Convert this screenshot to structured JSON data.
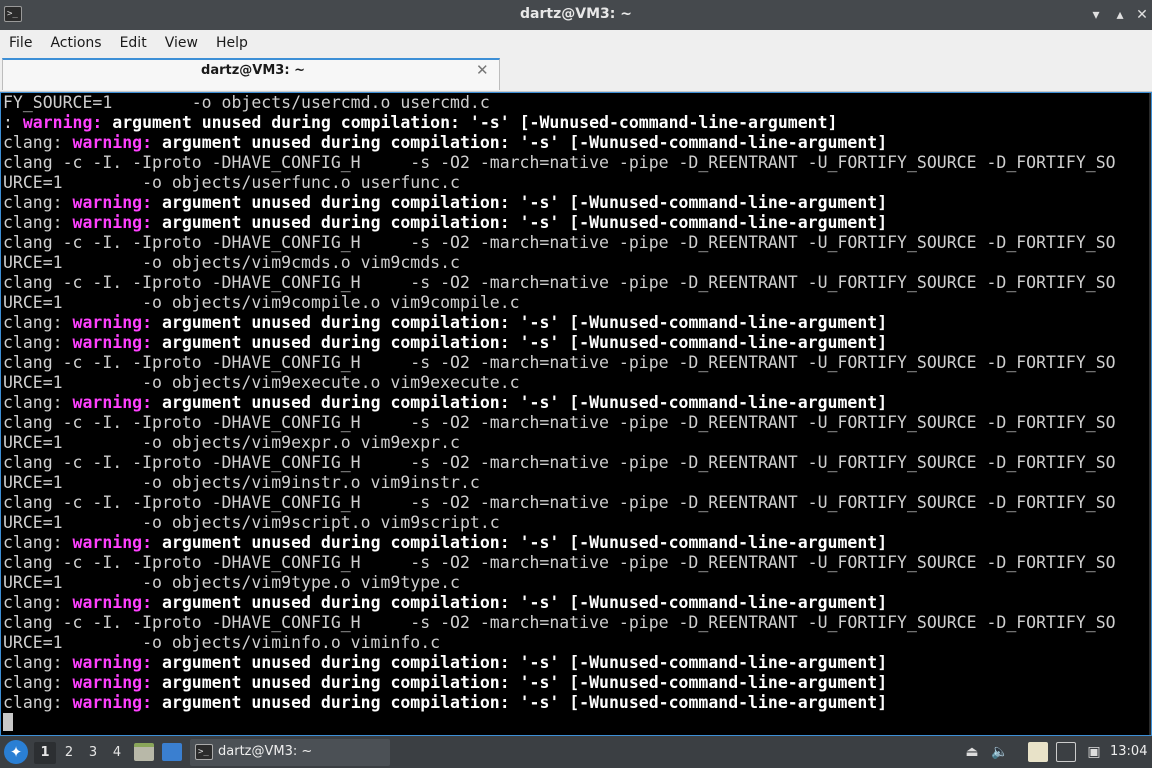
{
  "window": {
    "title": "dartz@VM3: ~",
    "minimize": "▾",
    "maximize": "▴",
    "close": "✕"
  },
  "menu": [
    "File",
    "Actions",
    "Edit",
    "View",
    "Help"
  ],
  "tab": {
    "label": "dartz@VM3: ~",
    "close": "✕"
  },
  "colors": {
    "warning": "#ff40ff",
    "accent": "#3d8fd6",
    "terminal_bg": "#000000"
  },
  "terminal_lines": [
    [
      {
        "t": "FY_SOURCE=1        -o objects/usercmd.o usercmd.c",
        "c": ""
      }
    ],
    [
      {
        "t": ": ",
        "c": ""
      },
      {
        "t": "warning:",
        "c": "warn"
      },
      {
        "t": " argument unused during compilation: '-s' [-Wunused-command-line-argument]",
        "c": "bold"
      }
    ],
    [
      {
        "t": "clang: ",
        "c": ""
      },
      {
        "t": "warning:",
        "c": "warn"
      },
      {
        "t": " argument unused during compilation: '-s' [-Wunused-command-line-argument]",
        "c": "bold"
      }
    ],
    [
      {
        "t": "clang -c -I. -Iproto -DHAVE_CONFIG_H     -s -O2 -march=native -pipe -D_REENTRANT -U_FORTIFY_SOURCE -D_FORTIFY_SO",
        "c": ""
      }
    ],
    [
      {
        "t": "URCE=1        -o objects/userfunc.o userfunc.c",
        "c": ""
      }
    ],
    [
      {
        "t": "clang: ",
        "c": ""
      },
      {
        "t": "warning:",
        "c": "warn"
      },
      {
        "t": " argument unused during compilation: '-s' [-Wunused-command-line-argument]",
        "c": "bold"
      }
    ],
    [
      {
        "t": "clang: ",
        "c": ""
      },
      {
        "t": "warning:",
        "c": "warn"
      },
      {
        "t": " argument unused during compilation: '-s' [-Wunused-command-line-argument]",
        "c": "bold"
      }
    ],
    [
      {
        "t": "clang -c -I. -Iproto -DHAVE_CONFIG_H     -s -O2 -march=native -pipe -D_REENTRANT -U_FORTIFY_SOURCE -D_FORTIFY_SO",
        "c": ""
      }
    ],
    [
      {
        "t": "URCE=1        -o objects/vim9cmds.o vim9cmds.c",
        "c": ""
      }
    ],
    [
      {
        "t": "clang -c -I. -Iproto -DHAVE_CONFIG_H     -s -O2 -march=native -pipe -D_REENTRANT -U_FORTIFY_SOURCE -D_FORTIFY_SO",
        "c": ""
      }
    ],
    [
      {
        "t": "URCE=1        -o objects/vim9compile.o vim9compile.c",
        "c": ""
      }
    ],
    [
      {
        "t": "clang: ",
        "c": ""
      },
      {
        "t": "warning:",
        "c": "warn"
      },
      {
        "t": " argument unused during compilation: '-s' [-Wunused-command-line-argument]",
        "c": "bold"
      }
    ],
    [
      {
        "t": "clang: ",
        "c": ""
      },
      {
        "t": "warning:",
        "c": "warn"
      },
      {
        "t": " argument unused during compilation: '-s' [-Wunused-command-line-argument]",
        "c": "bold"
      }
    ],
    [
      {
        "t": "clang -c -I. -Iproto -DHAVE_CONFIG_H     -s -O2 -march=native -pipe -D_REENTRANT -U_FORTIFY_SOURCE -D_FORTIFY_SO",
        "c": ""
      }
    ],
    [
      {
        "t": "URCE=1        -o objects/vim9execute.o vim9execute.c",
        "c": ""
      }
    ],
    [
      {
        "t": "clang: ",
        "c": ""
      },
      {
        "t": "warning:",
        "c": "warn"
      },
      {
        "t": " argument unused during compilation: '-s' [-Wunused-command-line-argument]",
        "c": "bold"
      }
    ],
    [
      {
        "t": "clang -c -I. -Iproto -DHAVE_CONFIG_H     -s -O2 -march=native -pipe -D_REENTRANT -U_FORTIFY_SOURCE -D_FORTIFY_SO",
        "c": ""
      }
    ],
    [
      {
        "t": "URCE=1        -o objects/vim9expr.o vim9expr.c",
        "c": ""
      }
    ],
    [
      {
        "t": "clang -c -I. -Iproto -DHAVE_CONFIG_H     -s -O2 -march=native -pipe -D_REENTRANT -U_FORTIFY_SOURCE -D_FORTIFY_SO",
        "c": ""
      }
    ],
    [
      {
        "t": "URCE=1        -o objects/vim9instr.o vim9instr.c",
        "c": ""
      }
    ],
    [
      {
        "t": "clang -c -I. -Iproto -DHAVE_CONFIG_H     -s -O2 -march=native -pipe -D_REENTRANT -U_FORTIFY_SOURCE -D_FORTIFY_SO",
        "c": ""
      }
    ],
    [
      {
        "t": "URCE=1        -o objects/vim9script.o vim9script.c",
        "c": ""
      }
    ],
    [
      {
        "t": "clang: ",
        "c": ""
      },
      {
        "t": "warning:",
        "c": "warn"
      },
      {
        "t": " argument unused during compilation: '-s' [-Wunused-command-line-argument]",
        "c": "bold"
      }
    ],
    [
      {
        "t": "clang -c -I. -Iproto -DHAVE_CONFIG_H     -s -O2 -march=native -pipe -D_REENTRANT -U_FORTIFY_SOURCE -D_FORTIFY_SO",
        "c": ""
      }
    ],
    [
      {
        "t": "URCE=1        -o objects/vim9type.o vim9type.c",
        "c": ""
      }
    ],
    [
      {
        "t": "clang: ",
        "c": ""
      },
      {
        "t": "warning:",
        "c": "warn"
      },
      {
        "t": " argument unused during compilation: '-s' [-Wunused-command-line-argument]",
        "c": "bold"
      }
    ],
    [
      {
        "t": "clang -c -I. -Iproto -DHAVE_CONFIG_H     -s -O2 -march=native -pipe -D_REENTRANT -U_FORTIFY_SOURCE -D_FORTIFY_SO",
        "c": ""
      }
    ],
    [
      {
        "t": "URCE=1        -o objects/viminfo.o viminfo.c",
        "c": ""
      }
    ],
    [
      {
        "t": "clang: ",
        "c": ""
      },
      {
        "t": "warning:",
        "c": "warn"
      },
      {
        "t": " argument unused during compilation: '-s' [-Wunused-command-line-argument]",
        "c": "bold"
      }
    ],
    [
      {
        "t": "clang: ",
        "c": ""
      },
      {
        "t": "warning:",
        "c": "warn"
      },
      {
        "t": " argument unused during compilation: '-s' [-Wunused-command-line-argument]",
        "c": "bold"
      }
    ],
    [
      {
        "t": "clang: ",
        "c": ""
      },
      {
        "t": "warning:",
        "c": "warn"
      },
      {
        "t": " argument unused during compilation: '-s' [-Wunused-command-line-argument]",
        "c": "bold"
      }
    ]
  ],
  "taskbar": {
    "workspaces": [
      "1",
      "2",
      "3",
      "4"
    ],
    "active_workspace": "1",
    "task_label": "dartz@VM3: ~",
    "tray_icons": [
      "eject-icon",
      "volume-icon",
      "clipboard-icon",
      "network-icon",
      "screen-icon"
    ],
    "clock": "13:04"
  }
}
